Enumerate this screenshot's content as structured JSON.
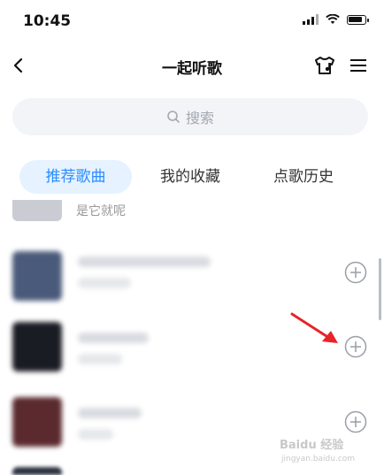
{
  "status": {
    "time": "10:45"
  },
  "header": {
    "title": "一起听歌"
  },
  "search": {
    "placeholder": "搜索"
  },
  "tabs": [
    {
      "label": "推荐歌曲",
      "active": true
    },
    {
      "label": "我的收藏",
      "active": false
    },
    {
      "label": "点歌历史",
      "active": false
    }
  ],
  "song_list": {
    "partial_item_text": "是它就呢",
    "items": [
      {
        "cover_color": "#4a5a7a"
      },
      {
        "cover_color": "#1a1c24"
      },
      {
        "cover_color": "#5a2a2e"
      }
    ]
  },
  "watermark": {
    "brand": "Baidu 经验",
    "url": "jingyan.baidu.com"
  },
  "colors": {
    "accent": "#2a8dff",
    "accent_bg": "#e6f2ff",
    "annotation": "#e8242a"
  }
}
